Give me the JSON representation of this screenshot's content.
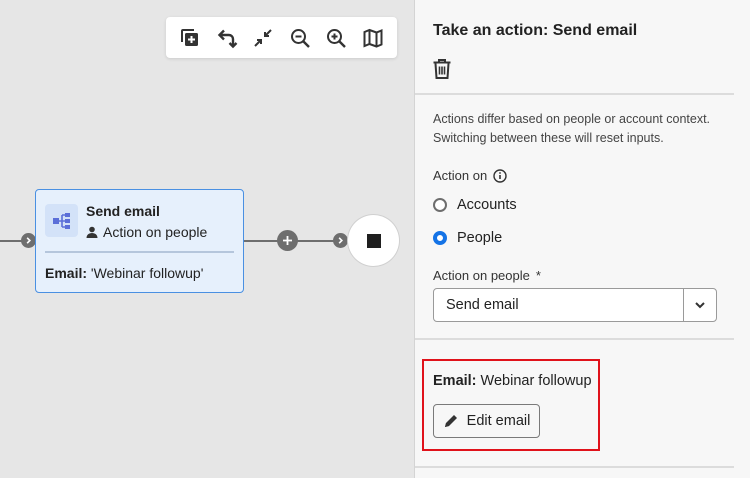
{
  "canvas": {
    "toolbar": [
      {
        "name": "duplicate-icon"
      },
      {
        "name": "undo-icon"
      },
      {
        "name": "collapse-icon"
      },
      {
        "name": "zoom-out-icon"
      },
      {
        "name": "zoom-in-icon"
      },
      {
        "name": "map-icon"
      }
    ],
    "node": {
      "title": "Send email",
      "subtitle": "Action on people",
      "email_label": "Email:",
      "email_value": "'Webinar followup'",
      "icon": "flow-icon"
    }
  },
  "panel": {
    "title": "Take an action: Send email",
    "note": "Actions differ based on people or account context. Switching between these will reset inputs.",
    "action_on_label": "Action on",
    "options": [
      {
        "label": "Accounts",
        "selected": false
      },
      {
        "label": "People",
        "selected": true
      }
    ],
    "action_on_people_label": "Action on people",
    "required_mark": "*",
    "select_value": "Send email",
    "email_label": "Email:",
    "email_value": "Webinar followup",
    "edit_button": "Edit email"
  },
  "colors": {
    "accent": "#1473e6",
    "node_border": "#4a90e2",
    "node_bg": "#e6f0fc",
    "highlight": "#e0121b"
  }
}
